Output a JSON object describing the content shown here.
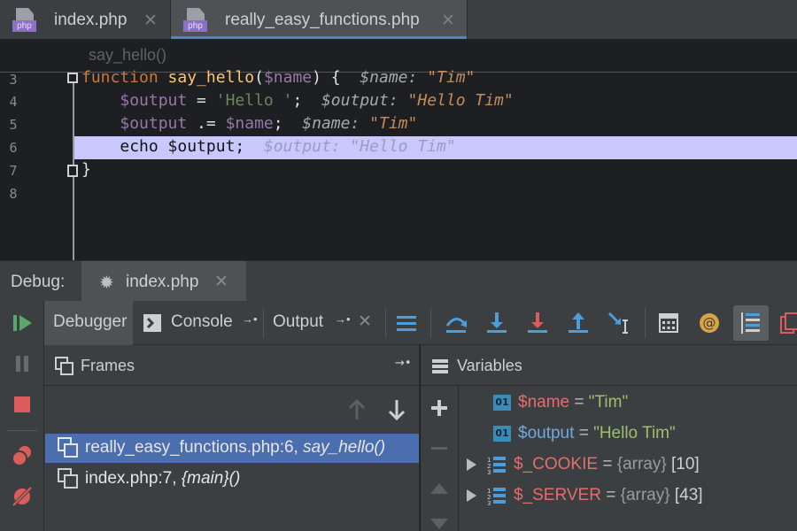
{
  "editor_tabs": [
    {
      "label": "index.php",
      "icon": "php-file-icon",
      "active": false
    },
    {
      "label": "really_easy_functions.php",
      "icon": "php-file-icon",
      "active": true
    }
  ],
  "php_badge": "php",
  "close_glyph": "✕",
  "breadcrumb": "say_hello()",
  "code": {
    "lines": [
      {
        "num": "3",
        "keyword": "function",
        "fname": "say_hello",
        "param": "$name",
        "tail": ") {",
        "hint_name": "$name:",
        "hint_val": "\"Tim\""
      },
      {
        "num": "4",
        "var": "$output",
        "op": " = ",
        "str": "'Hello '",
        "tail": ";",
        "hint_name": "$output:",
        "hint_val": "\"Hello Tim\""
      },
      {
        "num": "5",
        "var": "$output",
        "op": " .= ",
        "var2": "$name",
        "tail": ";",
        "hint_name": "$name:",
        "hint_val": "\"Tim\""
      },
      {
        "num": "6",
        "text": "echo $output;",
        "hint": "$output: \"Hello Tim\""
      },
      {
        "num": "7",
        "text": "}"
      },
      {
        "num": "8",
        "text": ""
      }
    ],
    "current_line": "6"
  },
  "debug": {
    "label": "Debug:",
    "session_tab": "index.php",
    "tabs": [
      "Debugger",
      "Console",
      "Output"
    ],
    "tab_arrow": "→•",
    "toolbar_icons": [
      "layout-icon",
      "step-over-icon",
      "step-into-icon",
      "force-step-into-icon",
      "step-out-icon",
      "run-to-cursor-icon",
      "evaluate-icon",
      "watch-icon",
      "inline-values-icon",
      "restore-layout-icon"
    ],
    "side_icons": [
      "resume-icon",
      "pause-icon",
      "stop-icon",
      "view-breakpoints-icon",
      "mute-breakpoints-icon"
    ]
  },
  "frames": {
    "title": "Frames",
    "items": [
      {
        "file": "really_easy_functions.php:6,",
        "func": "say_hello()",
        "selected": true
      },
      {
        "file": "index.php:7,",
        "func": "{main}()",
        "selected": false
      }
    ]
  },
  "variables": {
    "title": "Variables",
    "items": [
      {
        "name": "$name",
        "eq": "=",
        "value": "\"Tim\"",
        "kind": "string",
        "badge": "01"
      },
      {
        "name": "$output",
        "eq": "=",
        "value": "\"Hello Tim\"",
        "kind": "string",
        "badge": "01"
      },
      {
        "name": "$_COOKIE",
        "eq": "=",
        "type": "{array}",
        "count": "[10]",
        "kind": "array"
      },
      {
        "name": "$_SERVER",
        "eq": "=",
        "type": "{array}",
        "count": "[43]",
        "kind": "array"
      }
    ]
  }
}
